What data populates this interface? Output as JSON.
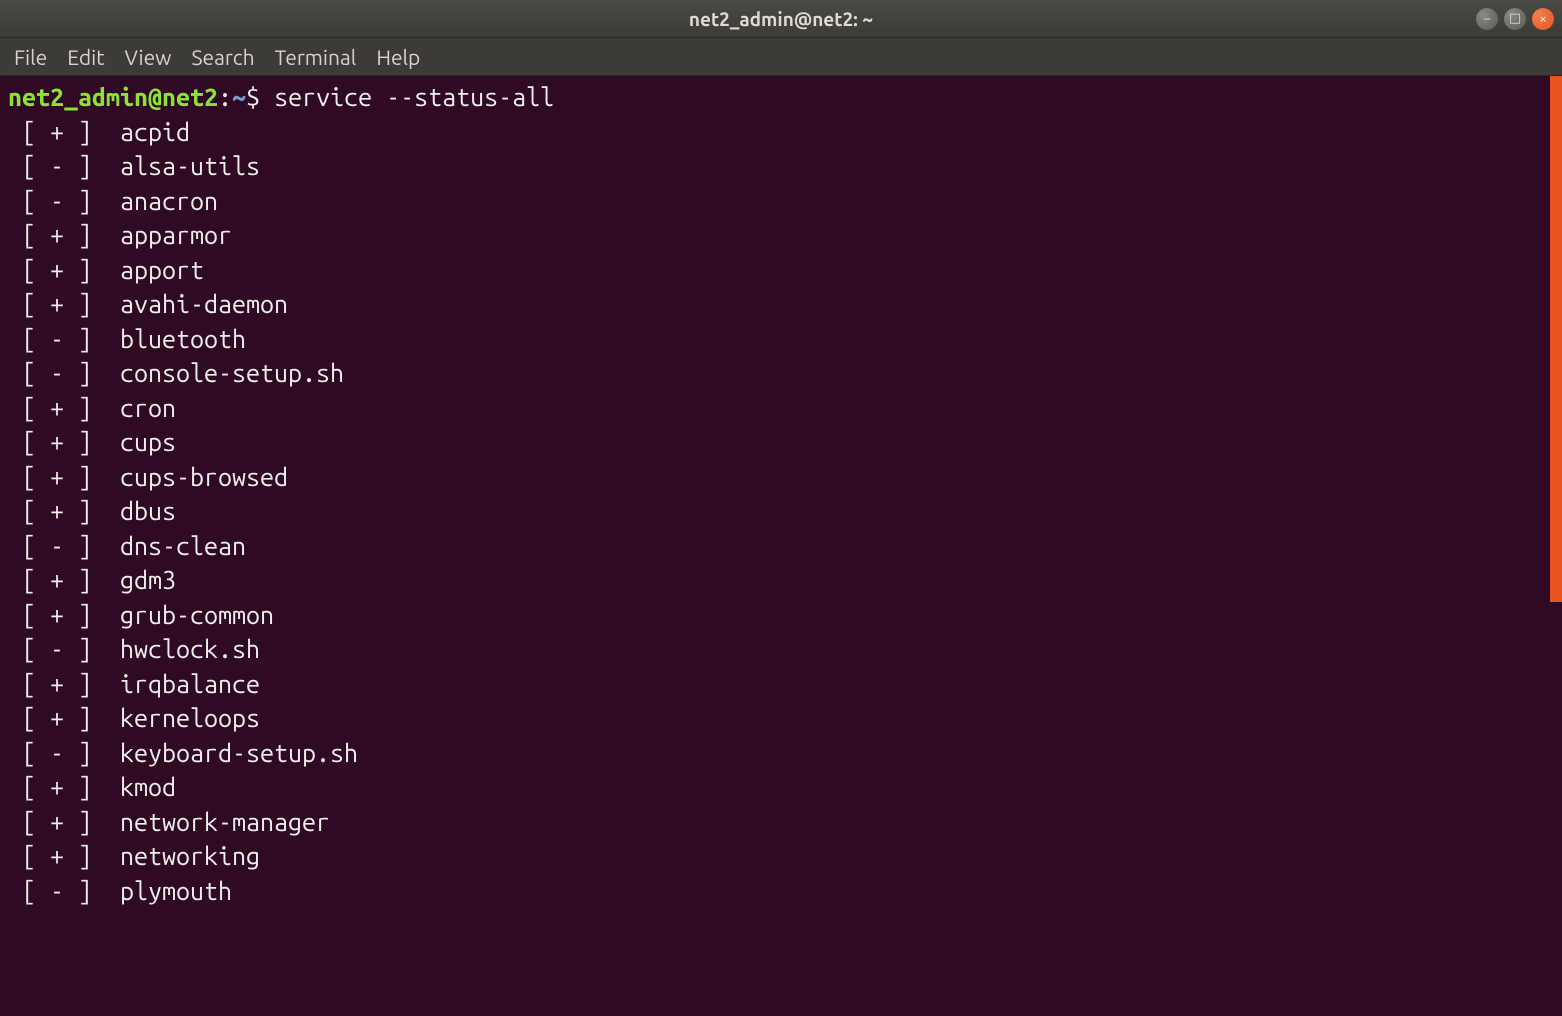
{
  "window": {
    "title": "net2_admin@net2: ~"
  },
  "menubar": {
    "items": [
      "File",
      "Edit",
      "View",
      "Search",
      "Terminal",
      "Help"
    ]
  },
  "prompt": {
    "user_host": "net2_admin@net2",
    "separator": ":",
    "path": "~",
    "symbol": "$ ",
    "command": "service --status-all"
  },
  "services": [
    {
      "status": "+",
      "name": "acpid"
    },
    {
      "status": "-",
      "name": "alsa-utils"
    },
    {
      "status": "-",
      "name": "anacron"
    },
    {
      "status": "+",
      "name": "apparmor"
    },
    {
      "status": "+",
      "name": "apport"
    },
    {
      "status": "+",
      "name": "avahi-daemon"
    },
    {
      "status": "-",
      "name": "bluetooth"
    },
    {
      "status": "-",
      "name": "console-setup.sh"
    },
    {
      "status": "+",
      "name": "cron"
    },
    {
      "status": "+",
      "name": "cups"
    },
    {
      "status": "+",
      "name": "cups-browsed"
    },
    {
      "status": "+",
      "name": "dbus"
    },
    {
      "status": "-",
      "name": "dns-clean"
    },
    {
      "status": "+",
      "name": "gdm3"
    },
    {
      "status": "+",
      "name": "grub-common"
    },
    {
      "status": "-",
      "name": "hwclock.sh"
    },
    {
      "status": "+",
      "name": "irqbalance"
    },
    {
      "status": "+",
      "name": "kerneloops"
    },
    {
      "status": "-",
      "name": "keyboard-setup.sh"
    },
    {
      "status": "+",
      "name": "kmod"
    },
    {
      "status": "+",
      "name": "network-manager"
    },
    {
      "status": "+",
      "name": "networking"
    },
    {
      "status": "-",
      "name": "plymouth"
    }
  ],
  "icons": {
    "minimize": "–",
    "maximize": "□",
    "close": "×"
  }
}
